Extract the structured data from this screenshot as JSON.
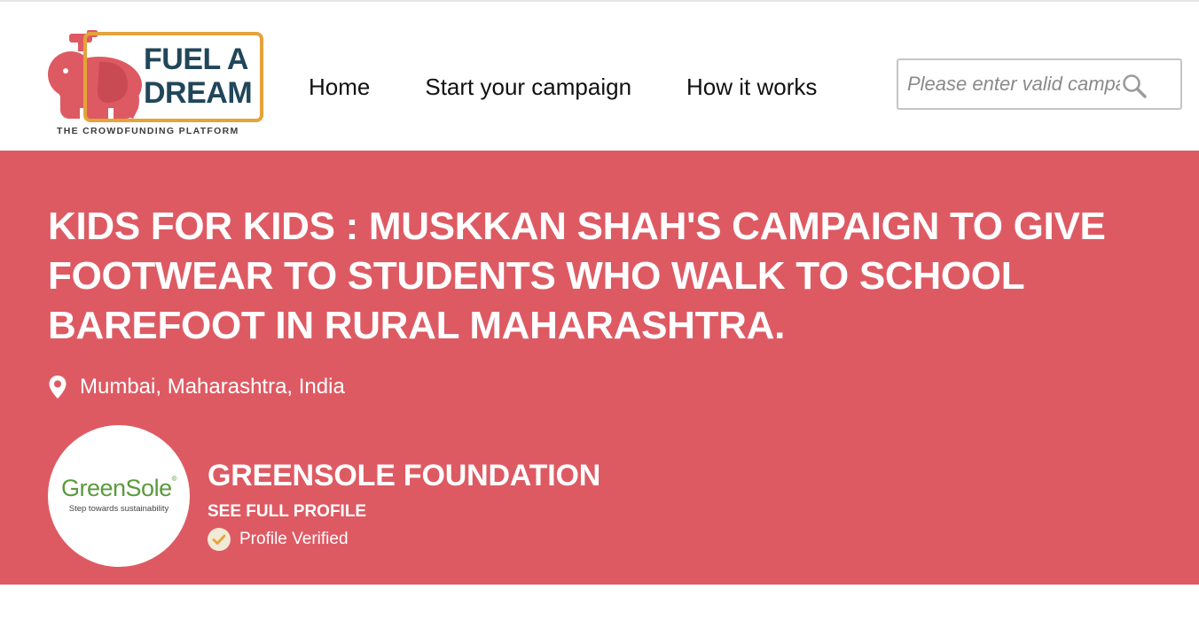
{
  "brand": {
    "logo_line1": "FUEL A",
    "logo_line2": "DREAM",
    "tagline": "THE CROWDFUNDING PLATFORM",
    "accent_color": "#e5a33a",
    "elephant_color": "#de5a63",
    "text_color": "#20465a"
  },
  "nav": {
    "items": [
      {
        "label": "Home"
      },
      {
        "label": "Start your campaign"
      },
      {
        "label": "How it works"
      }
    ]
  },
  "search": {
    "placeholder": "Please enter valid campaign name",
    "icon": "search-icon"
  },
  "campaign": {
    "title": "KIDS FOR KIDS : MUSKKAN SHAH'S CAMPAIGN TO GIVE FOOTWEAR TO STUDENTS WHO WALK TO SCHOOL BAREFOOT IN RURAL MAHARASHTRA.",
    "location": "Mumbai, Maharashtra, India",
    "location_icon": "map-pin-icon",
    "hero_color": "#de5a63"
  },
  "organization": {
    "logo_brand": "GreenSole",
    "logo_registered": "®",
    "logo_tagline": "Step towards sustainability",
    "name": "GREENSOLE FOUNDATION",
    "profile_link": "SEE FULL PROFILE",
    "verified_label": "Profile Verified",
    "verified_icon": "check-circle-icon"
  }
}
